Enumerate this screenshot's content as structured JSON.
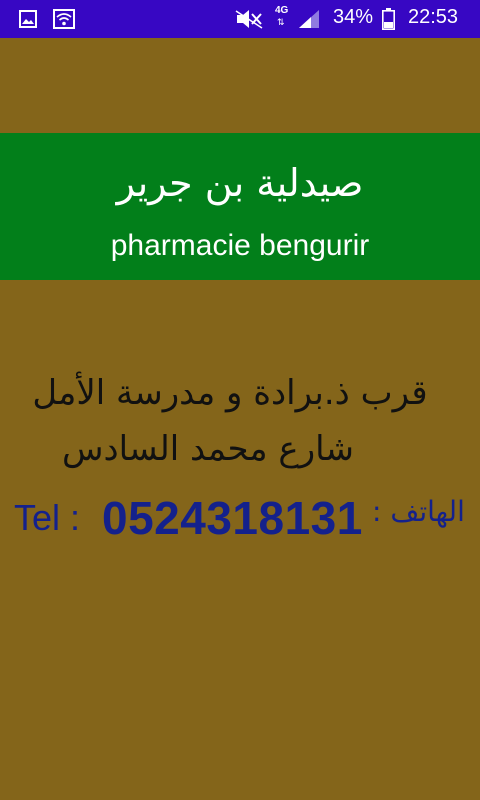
{
  "status_bar": {
    "network": "4G",
    "battery": "34%",
    "time": "22:53",
    "icons": [
      "gallery-icon",
      "wifi-icon",
      "mute-icon",
      "signal-icon",
      "battery-icon"
    ]
  },
  "header": {
    "title_arabic": "صيدلية بن جرير",
    "title_latin": "pharmacie bengurir"
  },
  "address": {
    "line1": "قرب ذ.برادة و مدرسة الأمل",
    "line2": "شارع محمد السادس"
  },
  "phone": {
    "label_latin": "Tel :",
    "number": "0524318131",
    "label_arabic": "الهاتف :"
  },
  "colors": {
    "status_bar": "#3707c3",
    "background": "#84651a",
    "header_band": "#027f1a",
    "phone_text": "#14218c"
  }
}
